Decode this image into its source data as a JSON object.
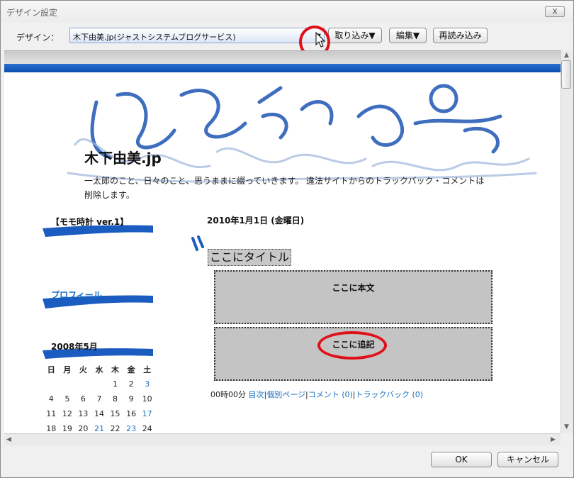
{
  "window": {
    "title": "デザイン設定",
    "close_label": "X"
  },
  "toolbar": {
    "design_label": "デザイン：",
    "design_value": "木下由美.jp(ジャストシステムブログサービス)",
    "import_button": "取り込み▼",
    "edit_button": "編集▼",
    "reload_button": "再読み込み"
  },
  "blog": {
    "title": "木下由美.jp",
    "description": "一太郎のこと、日々のこと、思うままに綴っていきます。 違法サイトからのトラックバック・コメントは削除します。"
  },
  "sidebar": {
    "clock_heading": "【モモ時計 ver.1】",
    "profile_heading": "プロフィール",
    "calendar_heading": "2008年5月",
    "weekdays": [
      "日",
      "月",
      "火",
      "水",
      "木",
      "金",
      "土"
    ],
    "weeks": [
      [
        "",
        "",
        "",
        "",
        "1",
        "2",
        "3"
      ],
      [
        "4",
        "5",
        "6",
        "7",
        "8",
        "9",
        "10"
      ],
      [
        "11",
        "12",
        "13",
        "14",
        "15",
        "16",
        "17"
      ],
      [
        "18",
        "19",
        "20",
        "21",
        "22",
        "23",
        "24"
      ]
    ]
  },
  "post": {
    "date": "2010年1月1日 (金曜日)",
    "title": "ここにタイトル",
    "body": "ここに本文",
    "extra": "ここに追記",
    "time": "00時00分",
    "link_index": "目次",
    "link_permalink": "個別ページ",
    "link_comments": "コメント (0)",
    "link_trackbacks": "トラックバック (0)",
    "separator": "|"
  },
  "dialog": {
    "ok_button": "OK",
    "cancel_button": "キャンセル"
  },
  "colors": {
    "accent_blue": "#0a4fb0",
    "highlight_red": "#e0101a",
    "link_blue": "#1a6fc0"
  }
}
